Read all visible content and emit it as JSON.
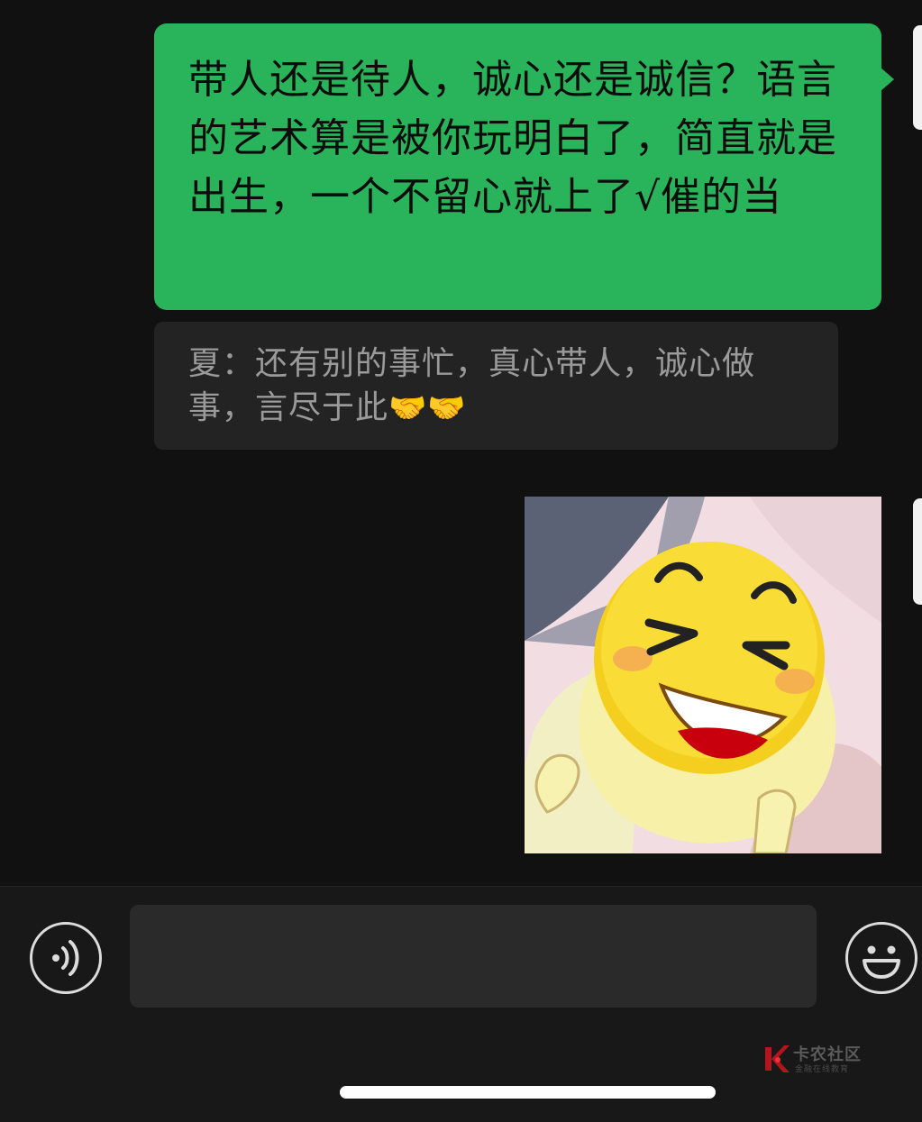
{
  "messages": {
    "outgoing_text": "带人还是待人，诚心还是诚信？语言的艺术算是被你玩明白了，简直就是出生，一个不留心就上了√催的当",
    "quote": {
      "text": "夏：还有别的事忙，真心带人，诚心做事，言尽于此",
      "emoji": "🤝🤝"
    },
    "sticker": "laughing-face-sticker"
  },
  "input_bar": {
    "voice_icon": "voice-icon",
    "input_value": "",
    "emoji_icon": "emoji-face-icon"
  },
  "watermark": {
    "title": "卡农社区",
    "subtitle": "金融在线教育"
  },
  "colors": {
    "background": "#111111",
    "outgoing_bubble": "#29b35a",
    "quote_bg": "#232323",
    "quote_text": "#9a9a9a",
    "input_bar": "#181818"
  }
}
